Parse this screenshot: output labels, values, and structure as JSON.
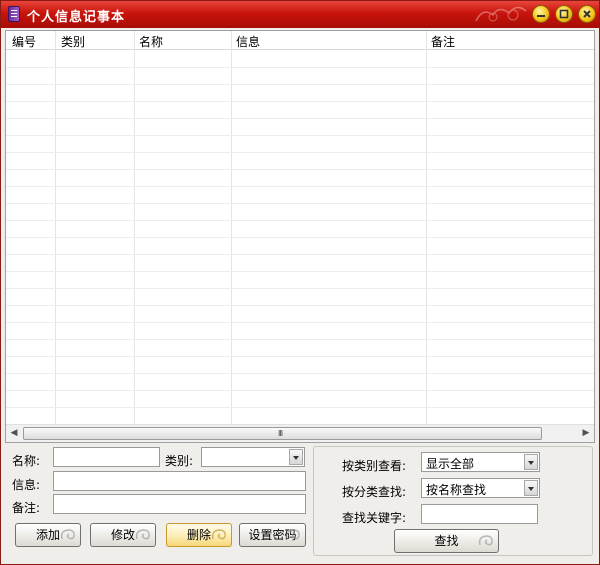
{
  "window": {
    "title": "个人信息记事本"
  },
  "table": {
    "columns": [
      "编号",
      "类别",
      "名称",
      "信息",
      "备注"
    ],
    "rows": []
  },
  "scrollbar": {
    "grip": "III"
  },
  "form": {
    "name_label": "名称:",
    "name_value": "",
    "category_label": "类别:",
    "category_value": "",
    "info_label": "信息:",
    "info_value": "",
    "note_label": "备注:",
    "note_value": ""
  },
  "actions": {
    "add": "添加",
    "modify": "修改",
    "delete": "删除",
    "set_password": "设置密码"
  },
  "search": {
    "view_by_category_label": "按类别查看:",
    "view_by_category_value": "显示全部",
    "search_by_type_label": "按分类查找:",
    "search_by_type_value": "按名称查找",
    "keyword_label": "查找关键字:",
    "keyword_value": "",
    "search_button": "查找"
  },
  "colors": {
    "titlebar": "#c8140c",
    "window_bg": "#f0eeea",
    "hot_button": "#f6d67a"
  }
}
